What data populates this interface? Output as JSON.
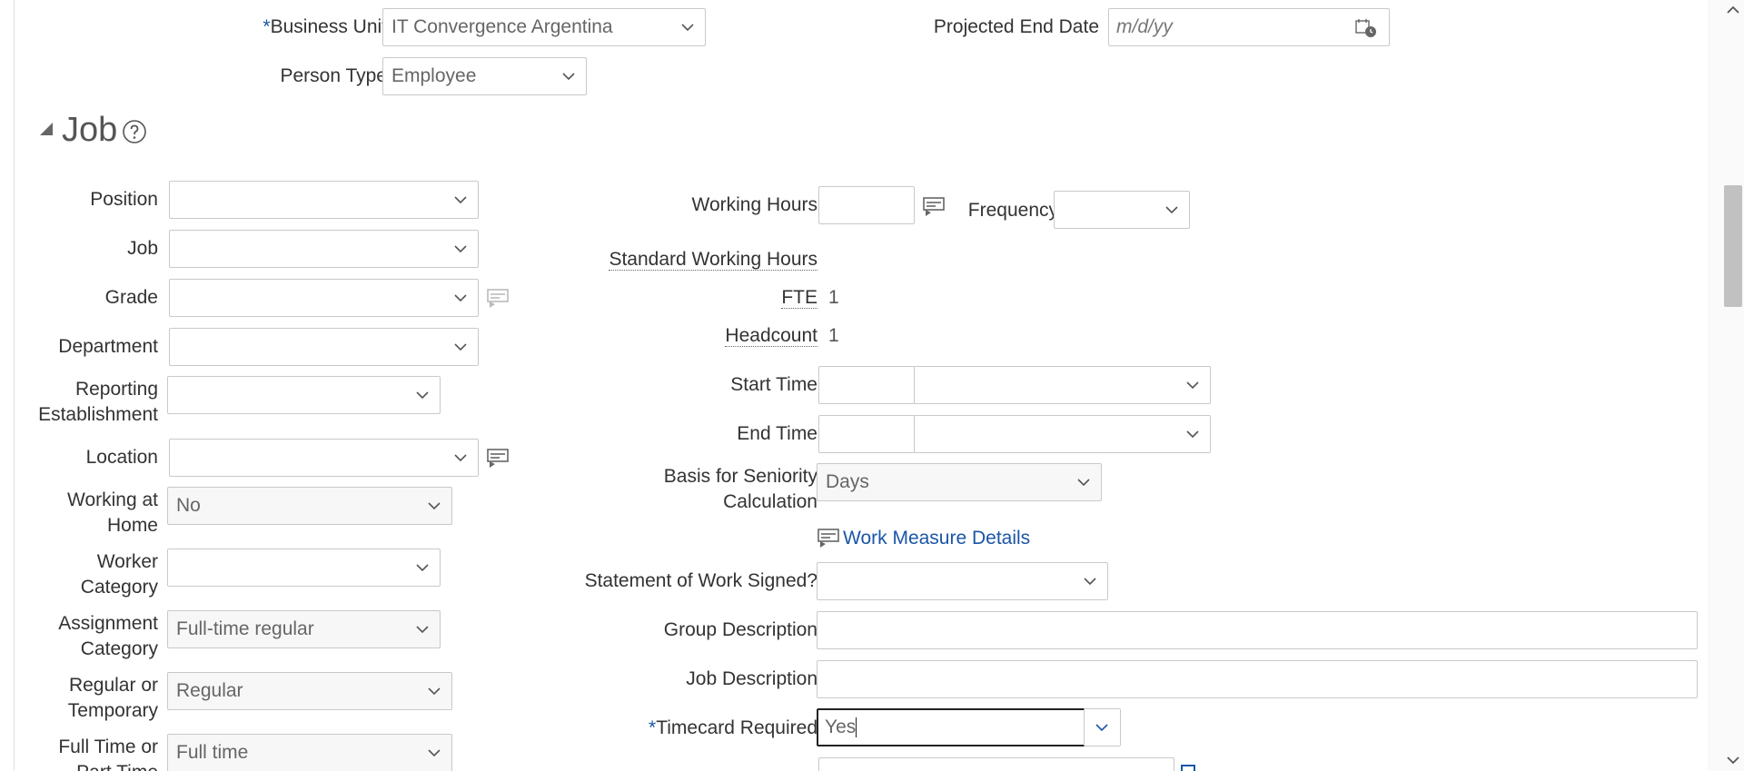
{
  "header_fields": {
    "business_unit_label": "Business Unit",
    "business_unit_required": "*",
    "business_unit_value": "IT Convergence Argentina",
    "person_type_label": "Person Type",
    "person_type_value": "Employee",
    "projected_end_date_label": "Projected End Date",
    "projected_end_date_placeholder": "m/d/yy"
  },
  "job_section": {
    "title": "Job",
    "left": {
      "position_label": "Position",
      "job_label": "Job",
      "grade_label": "Grade",
      "department_label": "Department",
      "reporting_establishment_label_1": "Reporting",
      "reporting_establishment_label_2": "Establishment",
      "location_label": "Location",
      "working_at_home_label_1": "Working at",
      "working_at_home_label_2": "Home",
      "working_at_home_value": "No",
      "worker_category_label_1": "Worker",
      "worker_category_label_2": "Category",
      "assignment_category_label_1": "Assignment",
      "assignment_category_label_2": "Category",
      "assignment_category_value": "Full-time regular",
      "regular_temporary_label_1": "Regular or",
      "regular_temporary_label_2": "Temporary",
      "regular_temporary_value": "Regular",
      "full_part_time_label_1": "Full Time or",
      "full_part_time_label_2": "Part Time",
      "full_part_time_value": "Full time"
    },
    "right": {
      "working_hours_label": "Working Hours",
      "frequency_label": "Frequency",
      "standard_working_hours_label": "Standard Working Hours",
      "fte_label": "FTE",
      "fte_value": "1",
      "headcount_label": "Headcount",
      "headcount_value": "1",
      "start_time_label": "Start Time",
      "end_time_label": "End Time",
      "seniority_label_1": "Basis for Seniority",
      "seniority_label_2": "Calculation",
      "seniority_value": "Days",
      "work_measure_link": "Work Measure Details",
      "statement_of_work_label": "Statement of Work Signed?",
      "group_description_label": "Group Description",
      "job_description_label": "Job Description",
      "timecard_required_label": "Timecard Required",
      "timecard_required_mark": "*",
      "timecard_required_value": "Yes"
    }
  },
  "icons": {
    "chevron": "chevron-down-icon",
    "calendar": "calendar-icon",
    "details": "details-icon",
    "help": "help-icon",
    "collapse": "collapse-triangle-icon"
  },
  "colors": {
    "link": "#1a56a6",
    "border": "#c9c9c9",
    "label": "#333333"
  }
}
